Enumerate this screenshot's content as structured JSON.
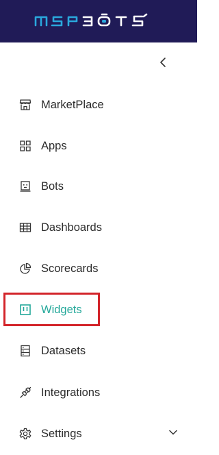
{
  "brand": {
    "logo_text": "MSPBOTS",
    "header_color": "#201b57",
    "accent_color": "#24a89a",
    "highlight_color": "#d3242a"
  },
  "sidebar": {
    "collapse_icon": "chevron-left-icon",
    "items": [
      {
        "label": "MarketPlace",
        "icon": "storefront-icon"
      },
      {
        "label": "Apps",
        "icon": "grid-icon"
      },
      {
        "label": "Bots",
        "icon": "bot-icon"
      },
      {
        "label": "Dashboards",
        "icon": "table-icon"
      },
      {
        "label": "Scorecards",
        "icon": "pie-chart-icon"
      },
      {
        "label": "Widgets",
        "icon": "widget-icon",
        "active": true
      },
      {
        "label": "Datasets",
        "icon": "dataset-icon"
      },
      {
        "label": "Integrations",
        "icon": "plug-icon"
      },
      {
        "label": "Settings",
        "icon": "gear-icon",
        "expand_icon": "chevron-down-icon"
      }
    ]
  }
}
